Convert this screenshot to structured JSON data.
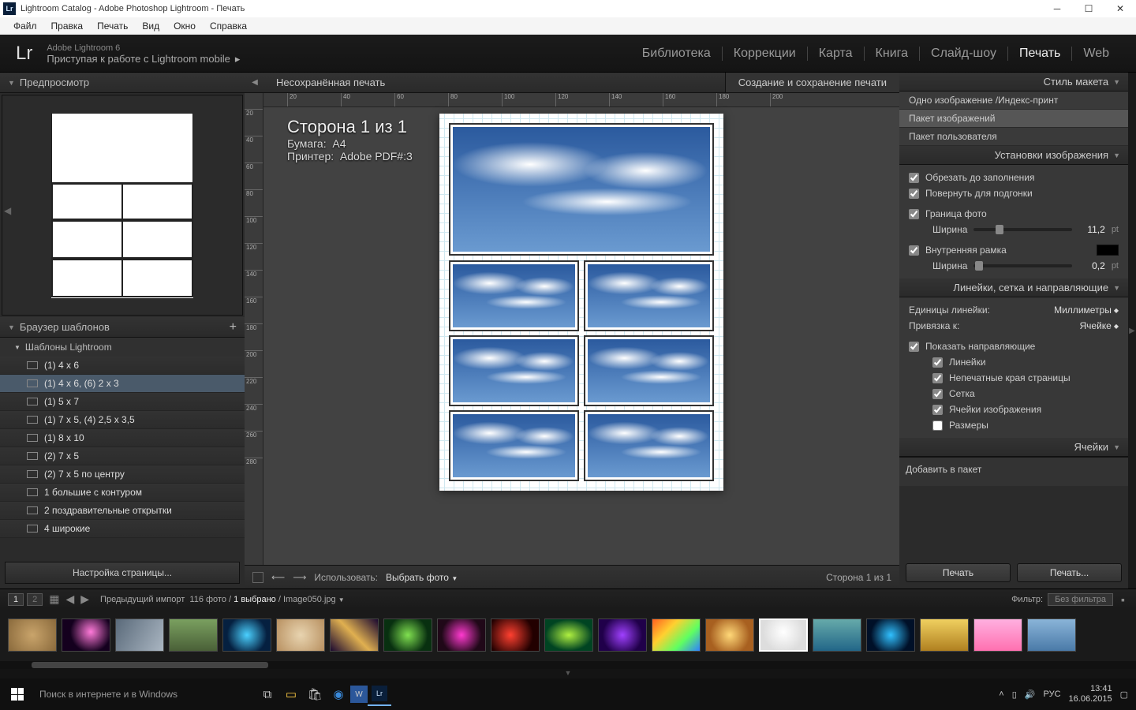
{
  "window": {
    "title": "Lightroom Catalog - Adobe Photoshop Lightroom - Печать",
    "appIconText": "Lr"
  },
  "menubar": [
    "Файл",
    "Правка",
    "Печать",
    "Вид",
    "Окно",
    "Справка"
  ],
  "header": {
    "logo": "Lr",
    "sub1": "Adobe Lightroom 6",
    "sub2": "Приступая к работе с Lightroom mobile",
    "modules": [
      "Библиотека",
      "Коррекции",
      "Карта",
      "Книга",
      "Слайд-шоу",
      "Печать",
      "Web"
    ],
    "activeModule": "Печать"
  },
  "left": {
    "previewTitle": "Предпросмотр",
    "browserTitle": "Браузер шаблонов",
    "groupTitle": "Шаблоны Lightroom",
    "templates": [
      "(1) 4 x 6",
      "(1) 4 x 6, (6) 2 x 3",
      "(1) 5 x 7",
      "(1) 7 x 5, (4) 2,5 x 3,5",
      "(1) 8 x 10",
      "(2) 7 x 5",
      "(2) 7 x 5 по центру",
      "1 большие с контуром",
      "2 поздравительные открытки",
      "4 широкие"
    ],
    "selectedTemplateIndex": 1,
    "pageSetupBtn": "Настройка страницы..."
  },
  "center": {
    "unsaved": "Несохранённая печать",
    "action": "Создание и сохранение печати",
    "pageInfo": {
      "title": "Сторона 1 из 1",
      "paperLabel": "Бумага:",
      "paperVal": "A4",
      "printerLabel": "Принтер:",
      "printerVal": "Adobe PDF#:3"
    },
    "rulerTop": [
      20,
      40,
      60,
      80,
      100,
      120,
      140,
      160,
      180,
      200
    ],
    "rulerLeft": [
      20,
      40,
      60,
      80,
      100,
      120,
      140,
      160,
      180,
      200,
      220,
      240,
      260,
      280
    ],
    "bottomBar": {
      "useLabel": "Использовать:",
      "useValue": "Выбрать фото",
      "pageStatus": "Сторона 1 из 1"
    }
  },
  "right": {
    "layoutStyle": {
      "title": "Стиль макета",
      "options": [
        "Одно изображение /Индекс-принт",
        "Пакет изображений",
        "Пакет пользователя"
      ],
      "selectedIndex": 1
    },
    "imageSettings": {
      "title": "Установки изображения",
      "cropToFill": "Обрезать до заполнения",
      "rotateToFit": "Повернуть для подгонки",
      "photoBorder": "Граница фото",
      "widthLabel": "Ширина",
      "borderValue": "11,2",
      "unitPt": "pt",
      "innerFrame": "Внутренняя рамка",
      "innerValue": "0,2"
    },
    "guides": {
      "title": "Линейки, сетка и направляющие",
      "unitsLabel": "Единицы линейки:",
      "unitsValue": "Миллиметры",
      "snapLabel": "Привязка к:",
      "snapValue": "Ячейке",
      "showGuides": "Показать направляющие",
      "items": [
        "Линейки",
        "Непечатные края страницы",
        "Сетка",
        "Ячейки изображения",
        "Размеры"
      ]
    },
    "cells": {
      "title": "Ячейки",
      "addLabel": "Добавить в пакет"
    },
    "printBtn1": "Печать",
    "printBtn2": "Печать..."
  },
  "filmstripBar": {
    "page1": "1",
    "page2": "2",
    "pathPrefix": "Предыдущий импорт",
    "count": "116 фото",
    "selected": "1 выбрано",
    "filename": "Image050.jpg",
    "filterLabel": "Фильтр:",
    "filterValue": "Без фильтра"
  },
  "taskbar": {
    "searchPlaceholder": "Поиск в интернете и в Windows",
    "lang": "РУС",
    "time": "13:41",
    "date": "16.06.2015"
  }
}
